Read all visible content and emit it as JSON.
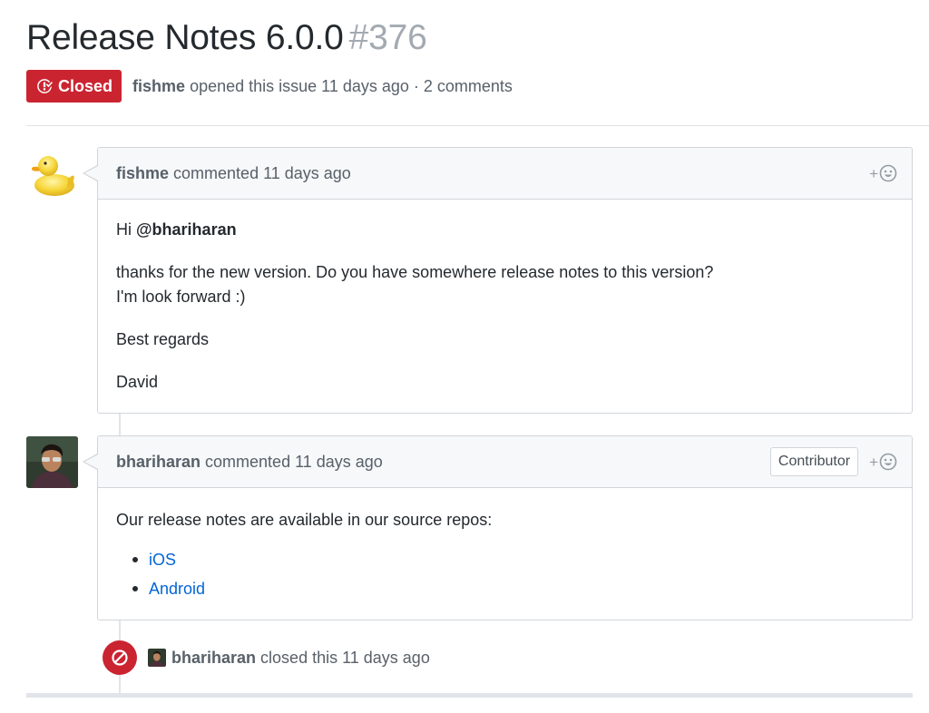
{
  "issue": {
    "title": "Release Notes 6.0.0",
    "number": "#376",
    "state": "Closed",
    "author": "fishme",
    "meta_text": "opened this issue 11 days ago · 2 comments"
  },
  "comments": [
    {
      "author": "fishme",
      "action": "commented 11 days ago",
      "avatar": "duck-avatar",
      "body": {
        "greeting": "Hi ",
        "mention": "@bhariharan",
        "line1": "thanks for the new version. Do you have somewhere release notes to this version?",
        "line2": "I'm look forward :)",
        "closing": "Best regards",
        "signature": "David"
      }
    },
    {
      "author": "bhariharan",
      "action": "commented 11 days ago",
      "role": "Contributor",
      "avatar": "person-avatar",
      "body": {
        "intro": "Our release notes are available in our source repos:",
        "links": [
          "iOS",
          "Android"
        ]
      }
    }
  ],
  "event": {
    "actor": "bhariharan",
    "text": "closed this 11 days ago"
  },
  "reaction": {
    "plus": "+"
  },
  "colors": {
    "closed_red": "#cb2431",
    "link_blue": "#0366d6",
    "muted": "#586069",
    "border": "#d1d5da",
    "header_bg": "#f6f8fa"
  }
}
